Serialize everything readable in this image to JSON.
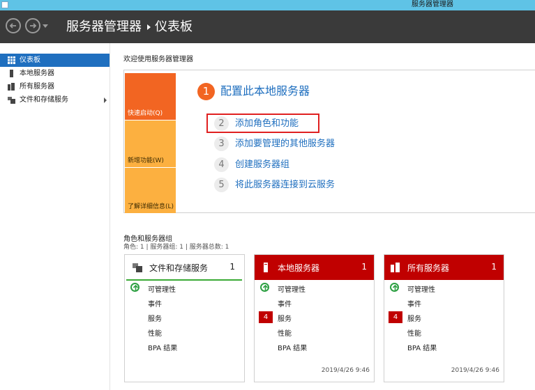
{
  "window": {
    "title": "服务器管理器"
  },
  "header": {
    "app_name": "服务器管理器",
    "page": "仪表板"
  },
  "sidebar": {
    "items": [
      {
        "label": "仪表板",
        "active": true,
        "icon": "dashboard-icon"
      },
      {
        "label": "本地服务器",
        "active": false,
        "icon": "server-icon"
      },
      {
        "label": "所有服务器",
        "active": false,
        "icon": "servers-icon"
      },
      {
        "label": "文件和存储服务",
        "active": false,
        "icon": "storage-icon",
        "expandable": true
      }
    ]
  },
  "welcome": {
    "title": "欢迎使用服务器管理器",
    "tiles": {
      "quick_start": "快速启动(Q)",
      "whats_new": "新增功能(W)",
      "learn_more": "了解详细信息(L)"
    },
    "step1": {
      "number": "1",
      "label": "配置此本地服务器"
    },
    "steps": [
      {
        "number": "2",
        "label": "添加角色和功能"
      },
      {
        "number": "3",
        "label": "添加要管理的其他服务器"
      },
      {
        "number": "4",
        "label": "创建服务器组"
      },
      {
        "number": "5",
        "label": "将此服务器连接到云服务"
      }
    ]
  },
  "roles": {
    "title": "角色和服务器组",
    "subtitle": "角色: 1 | 服务器组: 1 | 服务器总数: 1",
    "cards": [
      {
        "title": "文件和存储服务",
        "count": "1",
        "rows": [
          "可管理性",
          "事件",
          "服务",
          "性能",
          "BPA 结果"
        ],
        "service_badge": "",
        "timestamp": ""
      },
      {
        "title": "本地服务器",
        "count": "1",
        "rows": [
          "可管理性",
          "事件",
          "服务",
          "性能",
          "BPA 结果"
        ],
        "service_badge": "4",
        "timestamp": "2019/4/26 9:46"
      },
      {
        "title": "所有服务器",
        "count": "1",
        "rows": [
          "可管理性",
          "事件",
          "服务",
          "性能",
          "BPA 结果"
        ],
        "service_badge": "4",
        "timestamp": "2019/4/26 9:46"
      }
    ]
  },
  "colors": {
    "accent": "#1f6fbf",
    "alert": "#c00000",
    "quick_tile": "#f26522",
    "tile": "#fcb040",
    "ok": "#2ea043"
  }
}
